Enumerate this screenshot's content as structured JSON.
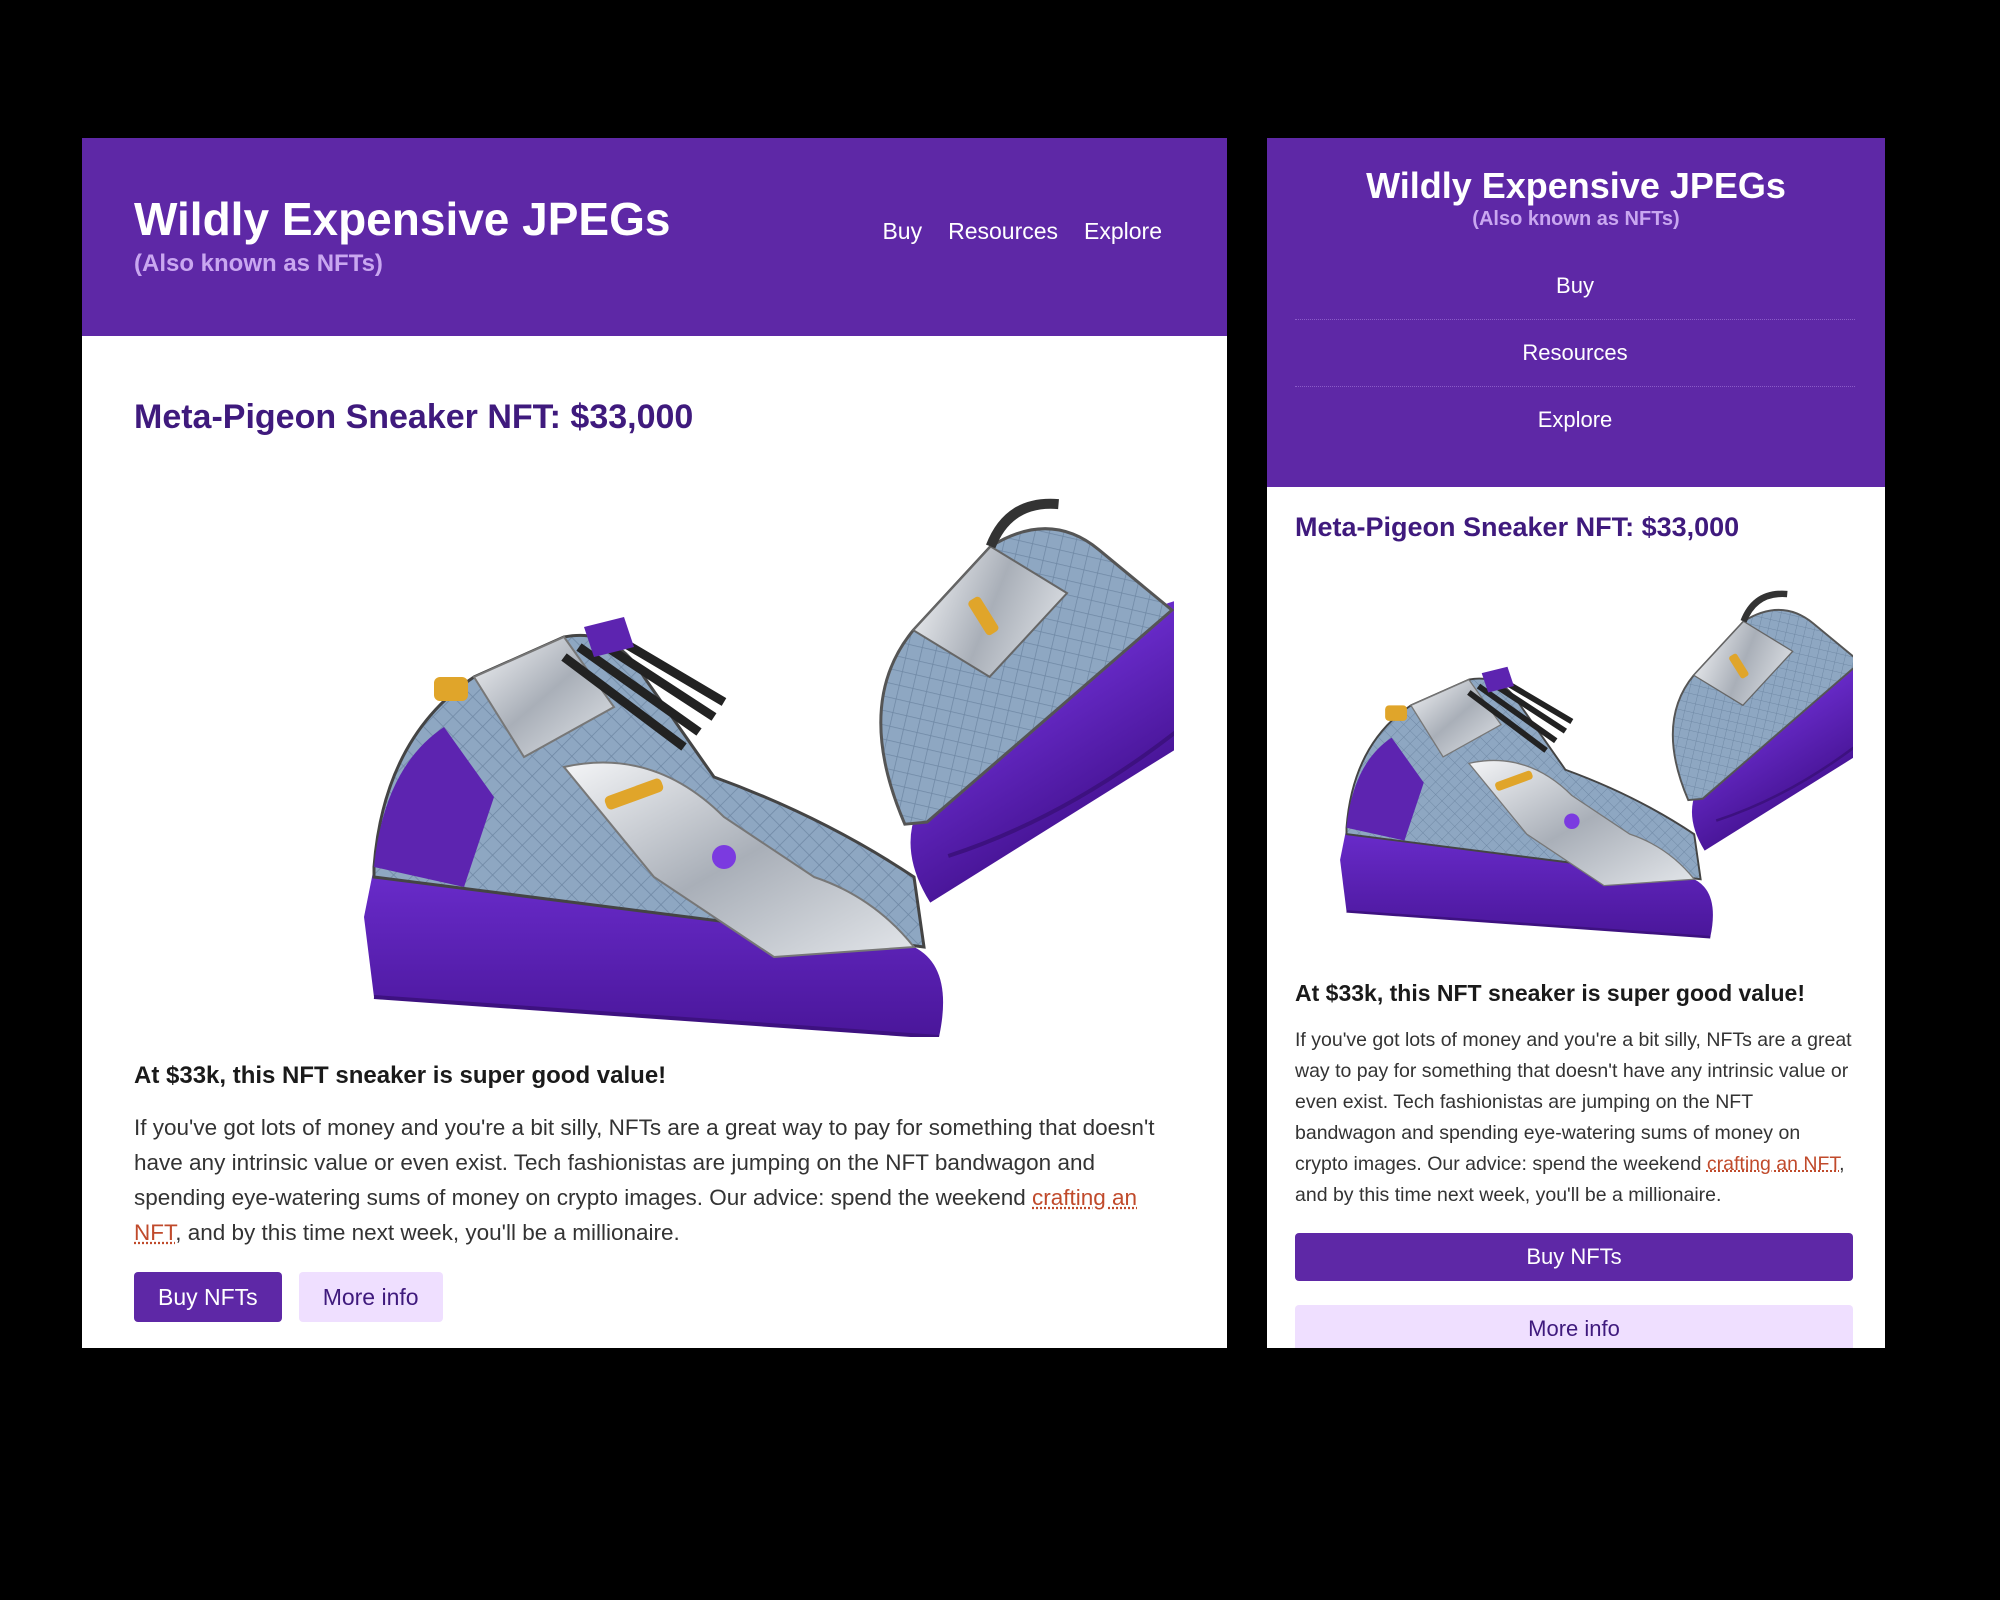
{
  "site": {
    "title": "Wildly Expensive JPEGs",
    "subtitle": "(Also known as NFTs)"
  },
  "nav": {
    "items": [
      "Buy",
      "Resources",
      "Explore"
    ]
  },
  "product": {
    "title": "Meta-Pigeon Sneaker NFT: $33,000",
    "tagline": "At $33k, this NFT sneaker is super good value!",
    "body_before_link": "If you've got lots of money and you're a bit silly, NFTs are a great way to pay for something that doesn't have any intrinsic value or even exist. Tech fashionistas are jumping on the NFT bandwagon and spending eye-watering sums of money on crypto images. Our advice: spend the weekend ",
    "link_text": "crafting an NFT",
    "body_after_link": ", and by this time next week, you'll be a millionaire.",
    "image_alt": "Meta-Pigeon sneaker image"
  },
  "buttons": {
    "buy": "Buy NFTs",
    "more_info": "More info"
  },
  "colors": {
    "header_bg": "#5e28a6",
    "subtitle": "#c9a7f0",
    "title_text": "#3f1a7d",
    "secondary_button_bg": "#efdfff",
    "link": "#c04a2b",
    "sneaker_sole": "#5a1fb0",
    "sneaker_upper": "#8ba4bf",
    "sneaker_chrome": "#c9ced6"
  },
  "icons": {
    "product_image": "sneaker-image"
  }
}
